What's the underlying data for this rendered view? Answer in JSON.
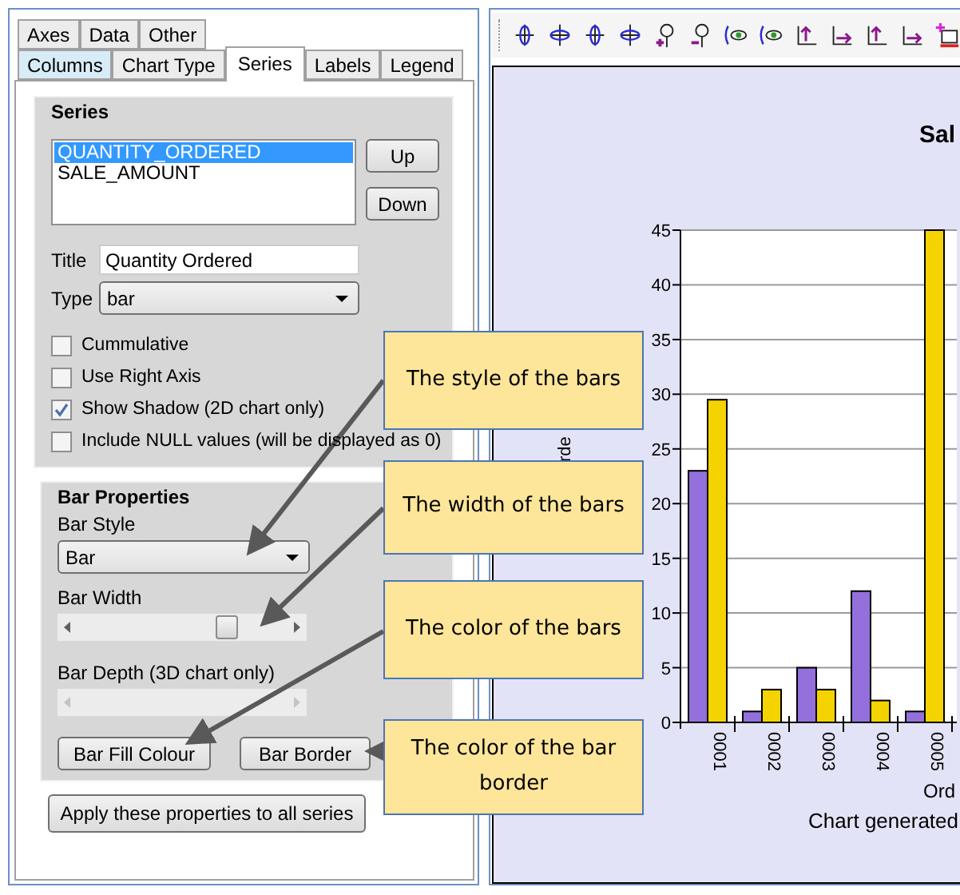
{
  "left_panel": {
    "tabs_row_1": [
      {
        "label": "Axes",
        "selected": false
      },
      {
        "label": "Data",
        "selected": false
      },
      {
        "label": "Other",
        "selected": false
      }
    ],
    "tabs_row_2": [
      {
        "label": "Columns",
        "selected": false,
        "hovered": true
      },
      {
        "label": "Chart Type",
        "selected": false,
        "hovered": false
      },
      {
        "label": "Series",
        "selected": true,
        "hovered": false
      },
      {
        "label": "Labels",
        "selected": false,
        "hovered": false
      },
      {
        "label": "Legend",
        "selected": false,
        "hovered": false
      }
    ],
    "series_group": {
      "title": "Series",
      "list": [
        {
          "label": "QUANTITY_ORDERED",
          "selected": true
        },
        {
          "label": "SALE_AMOUNT",
          "selected": false
        }
      ],
      "buttons": [
        "Up",
        "Down"
      ],
      "title_field": {
        "label": "Title",
        "value": "Quantity Ordered"
      },
      "type_field": {
        "label": "Type",
        "value": "bar"
      },
      "checkboxes": [
        {
          "label": "Cummulative",
          "checked": false
        },
        {
          "label": "Use Right Axis",
          "checked": false
        },
        {
          "label": "Show Shadow (2D chart only)",
          "checked": true
        },
        {
          "label": "Include NULL values (will be displayed as 0)",
          "checked": false
        }
      ]
    },
    "bar_group": {
      "title": "Bar Properties",
      "style_field": {
        "label": "Bar Style",
        "value": "Bar"
      },
      "width_slider": {
        "label": "Bar Width",
        "level": 0.7,
        "disabled": false
      },
      "depth_slider": {
        "label": "Bar Depth (3D chart only)",
        "disabled": true
      },
      "buttons": [
        "Bar Fill Colour",
        "Bar Border"
      ]
    },
    "apply_button": "Apply these properties to all series"
  },
  "chart_panel": {
    "chart_data": {
      "type": "bar",
      "title": "Sal",
      "xlabel": "Ord",
      "ylabel": "rde",
      "categories": [
        "0001",
        "0002",
        "0003",
        "0004",
        "0005"
      ],
      "series": [
        {
          "color": "#9370db",
          "values": [
            23,
            1,
            5,
            12,
            1
          ]
        },
        {
          "color": "#f5d300",
          "values": [
            29.5,
            3,
            3,
            2,
            45
          ]
        }
      ],
      "ylim": [
        0,
        45
      ],
      "grid": true,
      "yticks": [
        0,
        5,
        10,
        15,
        20,
        25,
        30,
        35,
        40,
        45
      ]
    },
    "footer": "Chart generated"
  },
  "callouts": [
    {
      "text": "The style of the bars"
    },
    {
      "text": "The width of the bars"
    },
    {
      "text": "The color of the bars"
    },
    {
      "text": "The color of the bar border"
    }
  ]
}
